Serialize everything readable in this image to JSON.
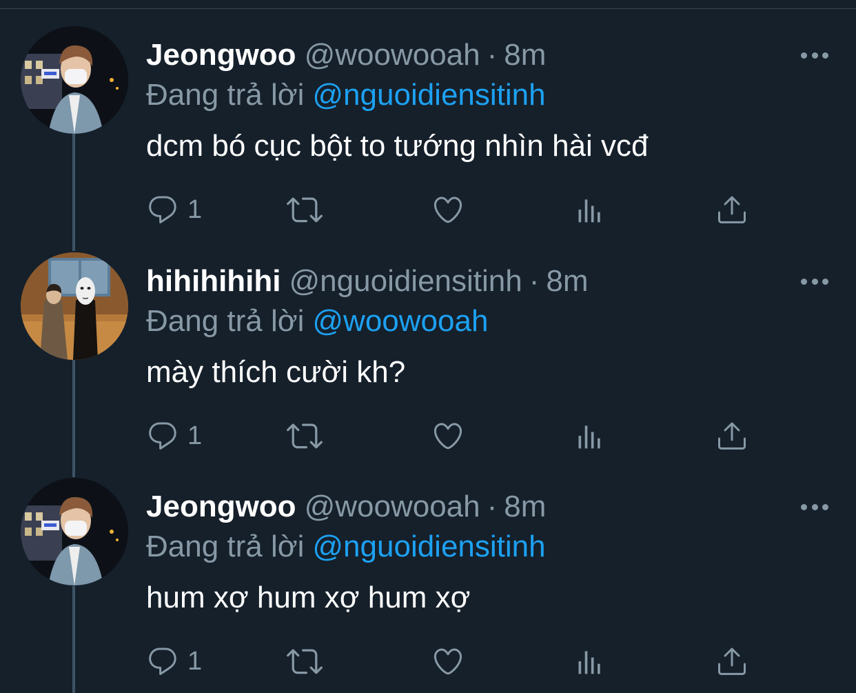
{
  "tweets": [
    {
      "display_name": "Jeongwoo",
      "handle": "@woowooah",
      "separator": "·",
      "time": "8m",
      "reply_prefix": "Đang trả lời",
      "reply_to": "@nguoidiensitinh",
      "text": "dcm bó cục bột to tướng nhìn hài vcđ",
      "reply_count": "1",
      "avatar": "avatar-jeongwoo"
    },
    {
      "display_name": "hihihihihi",
      "handle": "@nguoidiensitinh",
      "separator": "·",
      "time": "8m",
      "reply_prefix": "Đang trả lời",
      "reply_to": "@woowooah",
      "text": "mày thích cười kh?",
      "reply_count": "1",
      "avatar": "avatar-hihihihihi"
    },
    {
      "display_name": "Jeongwoo",
      "handle": "@woowooah",
      "separator": "·",
      "time": "8m",
      "reply_prefix": "Đang trả lời",
      "reply_to": "@nguoidiensitinh",
      "text": "hum xợ hum xợ hum xợ",
      "reply_count": "1",
      "avatar": "avatar-jeongwoo"
    }
  ],
  "icons": {
    "reply": "reply-icon",
    "retweet": "retweet-icon",
    "like": "heart-icon",
    "analytics": "analytics-icon",
    "share": "share-icon",
    "more": "more-icon"
  },
  "colors": {
    "background": "#15202b",
    "text_primary": "#ffffff",
    "text_secondary": "#8899a6",
    "link": "#1da1f2",
    "thread_line": "#3d5466"
  }
}
